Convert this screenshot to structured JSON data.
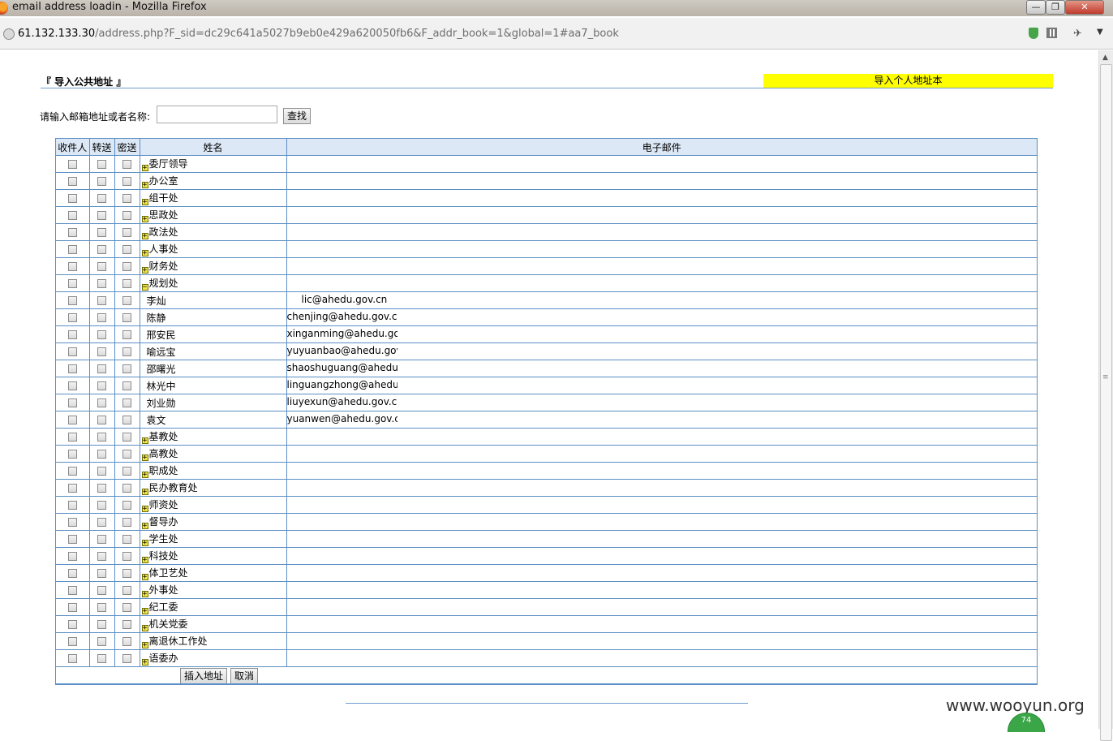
{
  "window": {
    "title": "email address loadin - Mozilla Firefox",
    "minimize": "—",
    "maximize": "❐",
    "close": "✕"
  },
  "browser": {
    "url_host": "61.132.133.30",
    "url_path": "/address.php?F_sid=dc29c641a5027b9eb0e429a620050fb6&F_addr_book=1&global=1#aa7_book"
  },
  "page": {
    "title": "『 导入公共地址 』",
    "personal_link": "导入个人地址本",
    "search": {
      "label": "请输入邮箱地址或者名称:",
      "value": "",
      "button": "查找"
    },
    "columns": {
      "to": "收件人",
      "cc": "转送",
      "bcc": "密送",
      "name": "姓名",
      "email": "电子邮件"
    },
    "rows": [
      {
        "type": "group",
        "name": "委厅领导",
        "email": ""
      },
      {
        "type": "group",
        "name": "办公室",
        "email": ""
      },
      {
        "type": "group",
        "name": "组干处",
        "email": ""
      },
      {
        "type": "group",
        "name": "思政处",
        "email": ""
      },
      {
        "type": "group",
        "name": "政法处",
        "email": ""
      },
      {
        "type": "group",
        "name": "人事处",
        "email": ""
      },
      {
        "type": "group",
        "name": "财务处",
        "email": ""
      },
      {
        "type": "group-open",
        "name": "规划处",
        "email": ""
      },
      {
        "type": "member",
        "name": "李灿",
        "email": "lic@ahedu.gov.cn",
        "indent": true
      },
      {
        "type": "member",
        "name": "陈静",
        "email": "chenjing@ahedu.gov.cn"
      },
      {
        "type": "member",
        "name": "邢安民",
        "email": "xinganming@ahedu.gov"
      },
      {
        "type": "member",
        "name": "喻远宝",
        "email": "yuyuanbao@ahedu.gov"
      },
      {
        "type": "member",
        "name": "邵曙光",
        "email": "shaoshuguang@ahedu."
      },
      {
        "type": "member",
        "name": "林光中",
        "email": "linguangzhong@ahedu."
      },
      {
        "type": "member",
        "name": "刘业勋",
        "email": "liuyexun@ahedu.gov.cn"
      },
      {
        "type": "member",
        "name": "袁文",
        "email": "yuanwen@ahedu.gov.cr"
      },
      {
        "type": "group",
        "name": "基教处",
        "email": ""
      },
      {
        "type": "group",
        "name": "高教处",
        "email": ""
      },
      {
        "type": "group",
        "name": "职成处",
        "email": ""
      },
      {
        "type": "group",
        "name": "民办教育处",
        "email": ""
      },
      {
        "type": "group",
        "name": "师资处",
        "email": ""
      },
      {
        "type": "group",
        "name": "督导办",
        "email": ""
      },
      {
        "type": "group",
        "name": "学生处",
        "email": ""
      },
      {
        "type": "group",
        "name": "科技处",
        "email": ""
      },
      {
        "type": "group",
        "name": "体卫艺处",
        "email": ""
      },
      {
        "type": "group",
        "name": "外事处",
        "email": ""
      },
      {
        "type": "group",
        "name": "纪工委",
        "email": ""
      },
      {
        "type": "group",
        "name": "机关党委",
        "email": ""
      },
      {
        "type": "group",
        "name": "离退休工作处",
        "email": ""
      },
      {
        "type": "group",
        "name": "语委办",
        "email": ""
      }
    ],
    "toggle": {
      "collapsed": "+",
      "expanded": "−"
    },
    "buttons": {
      "insert": "插入地址",
      "cancel": "取消"
    }
  },
  "overlay": {
    "watermark": "www.wooyun.org",
    "badge": "74"
  },
  "colors": {
    "highlight": "#ffff00",
    "border": "#5b8fc5",
    "header_bg": "#dce8f5",
    "toggle": "#f5e64a"
  }
}
